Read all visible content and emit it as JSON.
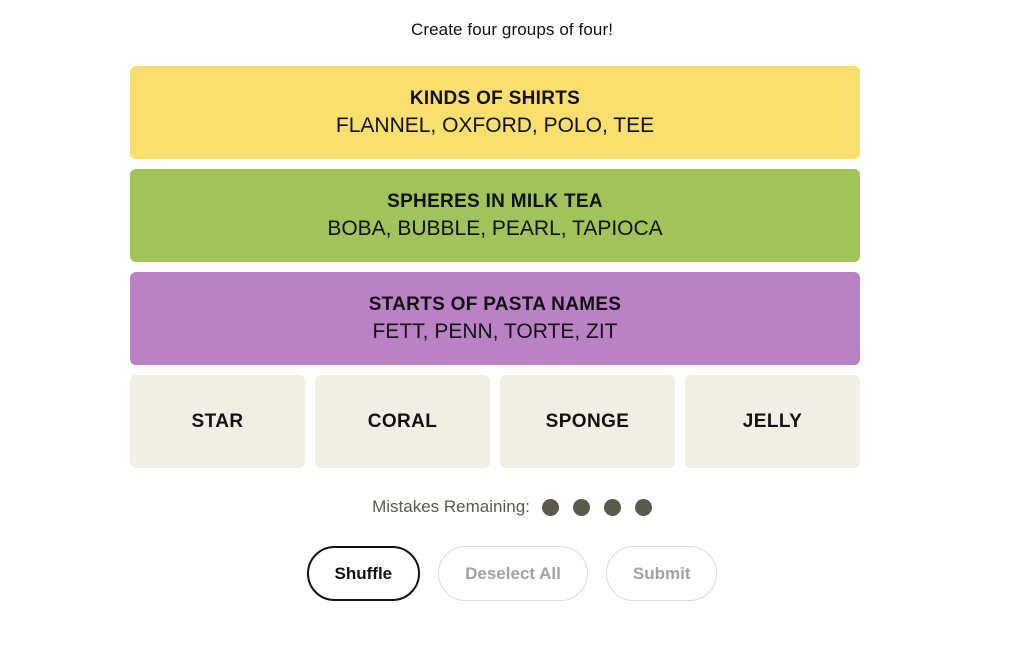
{
  "instruction": "Create four groups of four!",
  "colors": {
    "yellow": "#f9df6d",
    "green": "#a0c35a",
    "purple": "#ba81c5",
    "tile_bg": "#efefe6",
    "dot": "#5a594e",
    "text": "#121212",
    "disabled_text": "#a1a1a1"
  },
  "solved_groups": [
    {
      "title": "KINDS OF SHIRTS",
      "members": "FLANNEL, OXFORD, POLO, TEE",
      "color": "#f9df6d",
      "difficulty": "yellow"
    },
    {
      "title": "SPHERES IN MILK TEA",
      "members": "BOBA, BUBBLE, PEARL, TAPIOCA",
      "color": "#a0c35a",
      "difficulty": "green"
    },
    {
      "title": "STARTS OF PASTA NAMES",
      "members": "FETT, PENN, TORTE, ZIT",
      "color": "#ba81c5",
      "difficulty": "purple"
    }
  ],
  "remaining_tiles": [
    {
      "label": "STAR"
    },
    {
      "label": "CORAL"
    },
    {
      "label": "SPONGE"
    },
    {
      "label": "JELLY"
    }
  ],
  "mistakes": {
    "label": "Mistakes Remaining:",
    "remaining": 4,
    "dots": [
      1,
      2,
      3,
      4
    ]
  },
  "buttons": {
    "shuffle": {
      "label": "Shuffle",
      "enabled": true
    },
    "deselect": {
      "label": "Deselect All",
      "enabled": false
    },
    "submit": {
      "label": "Submit",
      "enabled": false
    }
  }
}
